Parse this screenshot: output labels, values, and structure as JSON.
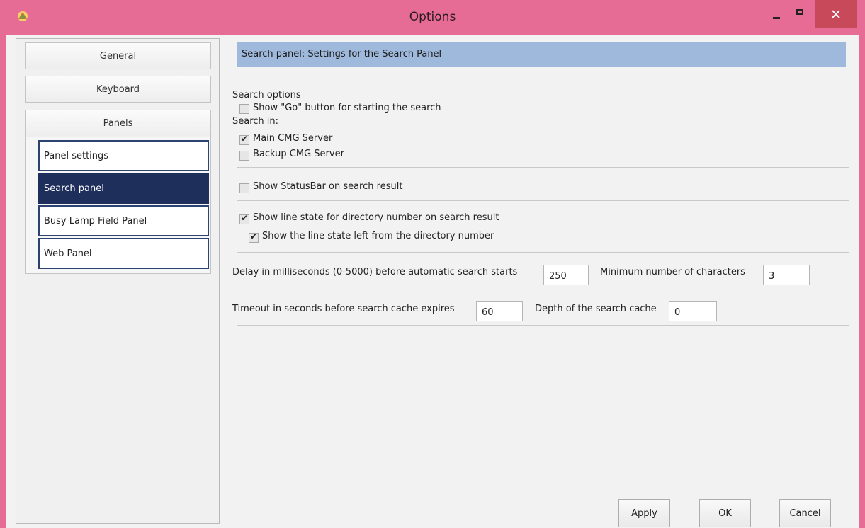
{
  "window": {
    "title": "Options"
  },
  "sidebar": {
    "items": [
      {
        "label": "General"
      },
      {
        "label": "Keyboard"
      }
    ],
    "panels": {
      "label": "Panels",
      "subitems": [
        {
          "label": "Panel settings"
        },
        {
          "label": "Search panel",
          "selected": true
        },
        {
          "label": "Busy Lamp Field Panel"
        },
        {
          "label": "Web Panel"
        }
      ]
    }
  },
  "content": {
    "header": "Search panel: Settings for the Search Panel",
    "search_options_label": "Search options",
    "show_go_button": {
      "label": "Show \"Go\" button for starting the search",
      "checked": false
    },
    "search_in_label": "Search in:",
    "main_server": {
      "label": "Main CMG Server",
      "checked": true
    },
    "backup_server": {
      "label": "Backup CMG Server",
      "checked": false
    },
    "show_statusbar": {
      "label": "Show StatusBar on search result",
      "checked": false
    },
    "show_line_state": {
      "label": "Show line state for directory number on search result",
      "checked": true
    },
    "show_line_state_left": {
      "label": "Show the line state left from the directory number",
      "checked": true
    },
    "delay": {
      "label": "Delay in milliseconds (0-5000) before automatic search starts",
      "value": "250"
    },
    "min_chars": {
      "label": "Minimum number of characters",
      "value": "3"
    },
    "timeout": {
      "label": "Timeout in seconds before search cache expires",
      "value": "60"
    },
    "depth": {
      "label": "Depth of the search cache",
      "value": "0"
    }
  },
  "buttons": {
    "apply": "Apply",
    "ok": "OK",
    "cancel": "Cancel"
  },
  "colors": {
    "titlebar": "#e66c95",
    "selected": "#1f2f5c",
    "header_bar": "#9eb9db"
  }
}
